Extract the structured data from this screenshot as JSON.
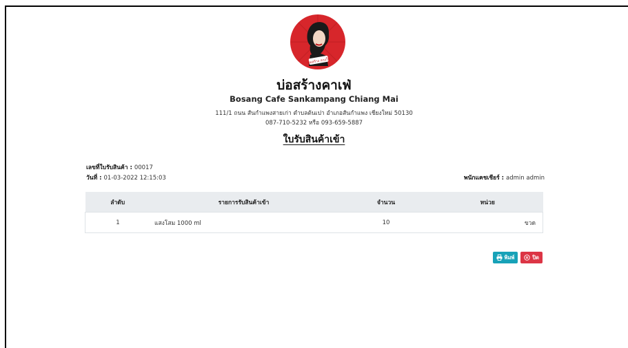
{
  "shop": {
    "name_th": "บ่อสร้างคาเฟ่",
    "name_en": "Bosang Cafe Sankampang Chiang Mai",
    "address": "111/1 ถนน สันกำแพงสายเก่า ตำบลต้นเปา อำเภอสันกำแพง เชียงใหม่ 50130",
    "phone": "087-710-5232 หรือ 093-659-5887",
    "logo_text": "บ่อสร้าง ลวงใจ"
  },
  "document": {
    "title": "ใบรับสินค้าเข้า",
    "receipt_no_label": "เลขที่ใบรับสินค้า : ",
    "receipt_no": "00017",
    "date_label": "วันที่ : ",
    "date": "01-03-2022 12:15:03",
    "cashier_label": "พนักแคชเชียร์ : ",
    "cashier": "admin  admin"
  },
  "table": {
    "headers": [
      "ลำดับ",
      "รายการรับสินค้าเข้า",
      "จำนวน",
      "หน่วย"
    ],
    "rows": [
      {
        "index": "1",
        "item": "แสงโสม 1000 ml",
        "qty": "10",
        "unit": "ขวด"
      }
    ]
  },
  "buttons": {
    "print_label": "พิมพ์",
    "close_label": "ปิด"
  },
  "colors": {
    "print": "#17a2b8",
    "close": "#dc3545",
    "logo": "#d7262b"
  }
}
